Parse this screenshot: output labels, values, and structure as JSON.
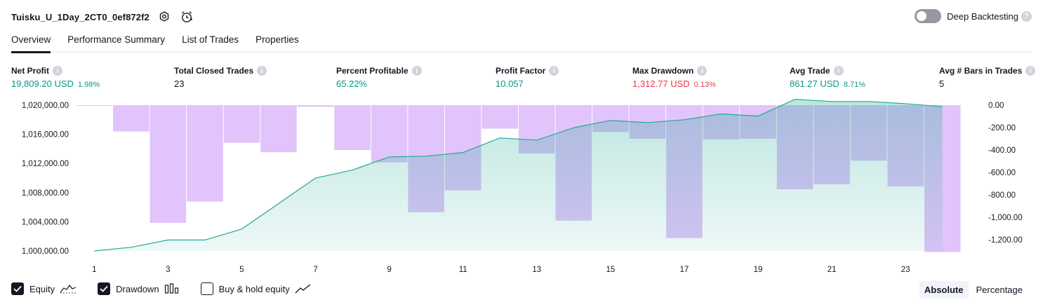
{
  "header": {
    "strategy_name": "Tuisku_U_1Day_2CT0_0ef872f2",
    "deep_backtesting_label": "Deep Backtesting",
    "deep_backtesting_enabled": false
  },
  "tabs": [
    {
      "label": "Overview",
      "active": true
    },
    {
      "label": "Performance Summary",
      "active": false
    },
    {
      "label": "List of Trades",
      "active": false
    },
    {
      "label": "Properties",
      "active": false
    }
  ],
  "metrics": {
    "net_profit": {
      "label": "Net Profit",
      "value": "19,809.20 USD",
      "pct": "1.98%"
    },
    "total_closed_trades": {
      "label": "Total Closed Trades",
      "value": "23"
    },
    "percent_profitable": {
      "label": "Percent Profitable",
      "value": "65.22%"
    },
    "profit_factor": {
      "label": "Profit Factor",
      "value": "10.057"
    },
    "max_drawdown": {
      "label": "Max Drawdown",
      "value": "1,312.77 USD",
      "pct": "0.13%"
    },
    "avg_trade": {
      "label": "Avg Trade",
      "value": "861.27 USD",
      "pct": "8.71%"
    },
    "avg_bars": {
      "label": "Avg # Bars in Trades",
      "value": "5"
    }
  },
  "colors": {
    "positive": "#089981",
    "negative": "#f23645",
    "equity_line": "#22ab94",
    "drawdown_bar": "#e1c4fb"
  },
  "chart_data": {
    "type": "line+bar",
    "x_ticks": [
      "1",
      "3",
      "5",
      "7",
      "9",
      "11",
      "13",
      "15",
      "17",
      "19",
      "21",
      "23"
    ],
    "left_axis": {
      "ticks": [
        "1,020,000.00",
        "1,016,000.00",
        "1,012,000.00",
        "1,008,000.00",
        "1,004,000.00",
        "1,000,000.00"
      ],
      "ylim": [
        1000000,
        1020000
      ]
    },
    "right_axis": {
      "ticks": [
        "0.00",
        "-200.00",
        "-400.00",
        "-600.00",
        "-800.00",
        "-1,000.00",
        "-1,200.00"
      ],
      "ylim": [
        -1300,
        0
      ]
    },
    "series": [
      {
        "name": "Equity",
        "x": [
          1,
          2,
          3,
          4,
          5,
          6,
          7,
          8,
          9,
          10,
          11,
          12,
          13,
          14,
          15,
          16,
          17,
          18,
          19,
          20,
          21,
          22,
          23,
          24
        ],
        "values": [
          1000000,
          1000500,
          1001500,
          1001500,
          1003000,
          1006500,
          1010000,
          1011100,
          1012900,
          1013000,
          1013500,
          1015500,
          1015200,
          1016900,
          1017900,
          1017600,
          1018000,
          1018800,
          1018500,
          1020800,
          1020500,
          1020500,
          1020200,
          1019800
        ]
      },
      {
        "name": "Drawdown",
        "x": [
          1,
          2,
          3,
          4,
          5,
          6,
          7,
          8,
          9,
          10,
          11,
          12,
          13,
          14,
          15,
          16,
          17,
          18,
          19,
          20,
          21,
          22,
          23,
          24
        ],
        "values": [
          0,
          -235,
          -1050,
          -860,
          -335,
          -420,
          -15,
          -400,
          -510,
          -955,
          -760,
          -210,
          -430,
          -1030,
          -240,
          -300,
          -1185,
          -305,
          -300,
          -750,
          -705,
          -495,
          -725,
          -1310
        ]
      }
    ]
  },
  "legend": {
    "equity": {
      "label": "Equity",
      "checked": true
    },
    "drawdown": {
      "label": "Drawdown",
      "checked": true
    },
    "buy_hold": {
      "label": "Buy & hold equity",
      "checked": false
    }
  },
  "view_modes": [
    {
      "label": "Absolute",
      "active": true
    },
    {
      "label": "Percentage",
      "active": false
    }
  ]
}
